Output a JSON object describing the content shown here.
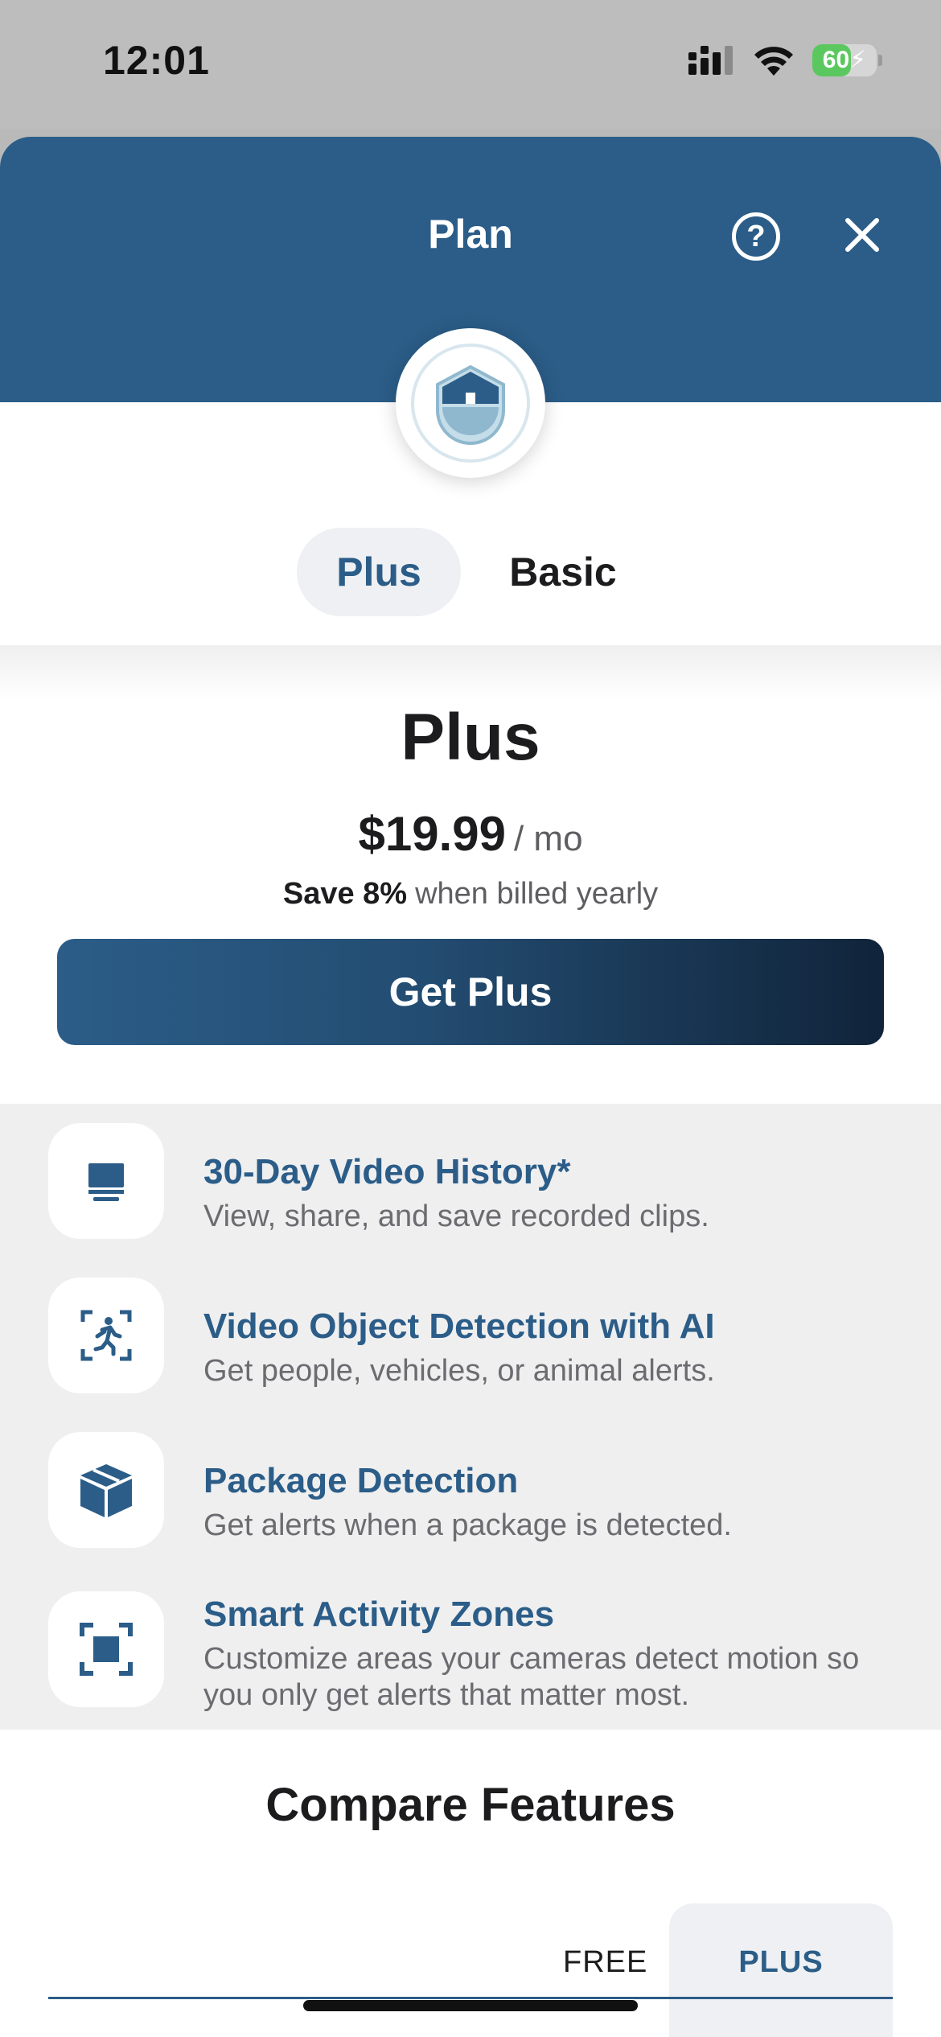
{
  "status_bar": {
    "time": "12:01",
    "battery": "60",
    "battery_level": 0.6
  },
  "header": {
    "title": "Plan"
  },
  "tabs": [
    {
      "label": "Plus",
      "selected": true
    },
    {
      "label": "Basic",
      "selected": false
    }
  ],
  "plan": {
    "name": "Plus",
    "price": "$19.99",
    "price_unit": "/ mo",
    "save_strong": "Save 8%",
    "save_rest": "when billed yearly",
    "cta_label": "Get Plus"
  },
  "features": [
    {
      "icon": "monitor-icon",
      "title": "30-Day Video History*",
      "description": "View, share, and save recorded clips."
    },
    {
      "icon": "person-detection-icon",
      "title": "Video Object Detection with AI",
      "description": "Get people, vehicles, or animal alerts."
    },
    {
      "icon": "package-icon",
      "title": "Package Detection",
      "description": "Get alerts when a package is detected."
    },
    {
      "icon": "activity-zone-icon",
      "title": "Smart Activity Zones",
      "description": "Customize areas your cameras detect motion so you only get alerts that matter most."
    }
  ],
  "compare": {
    "title": "Compare Features",
    "col_free": "FREE",
    "col_plus": "PLUS"
  },
  "colors": {
    "brand": "#2b5d88",
    "brand_dark": "#10243a",
    "feature_bg": "#efeff0",
    "battery_green": "#5bc85f"
  }
}
